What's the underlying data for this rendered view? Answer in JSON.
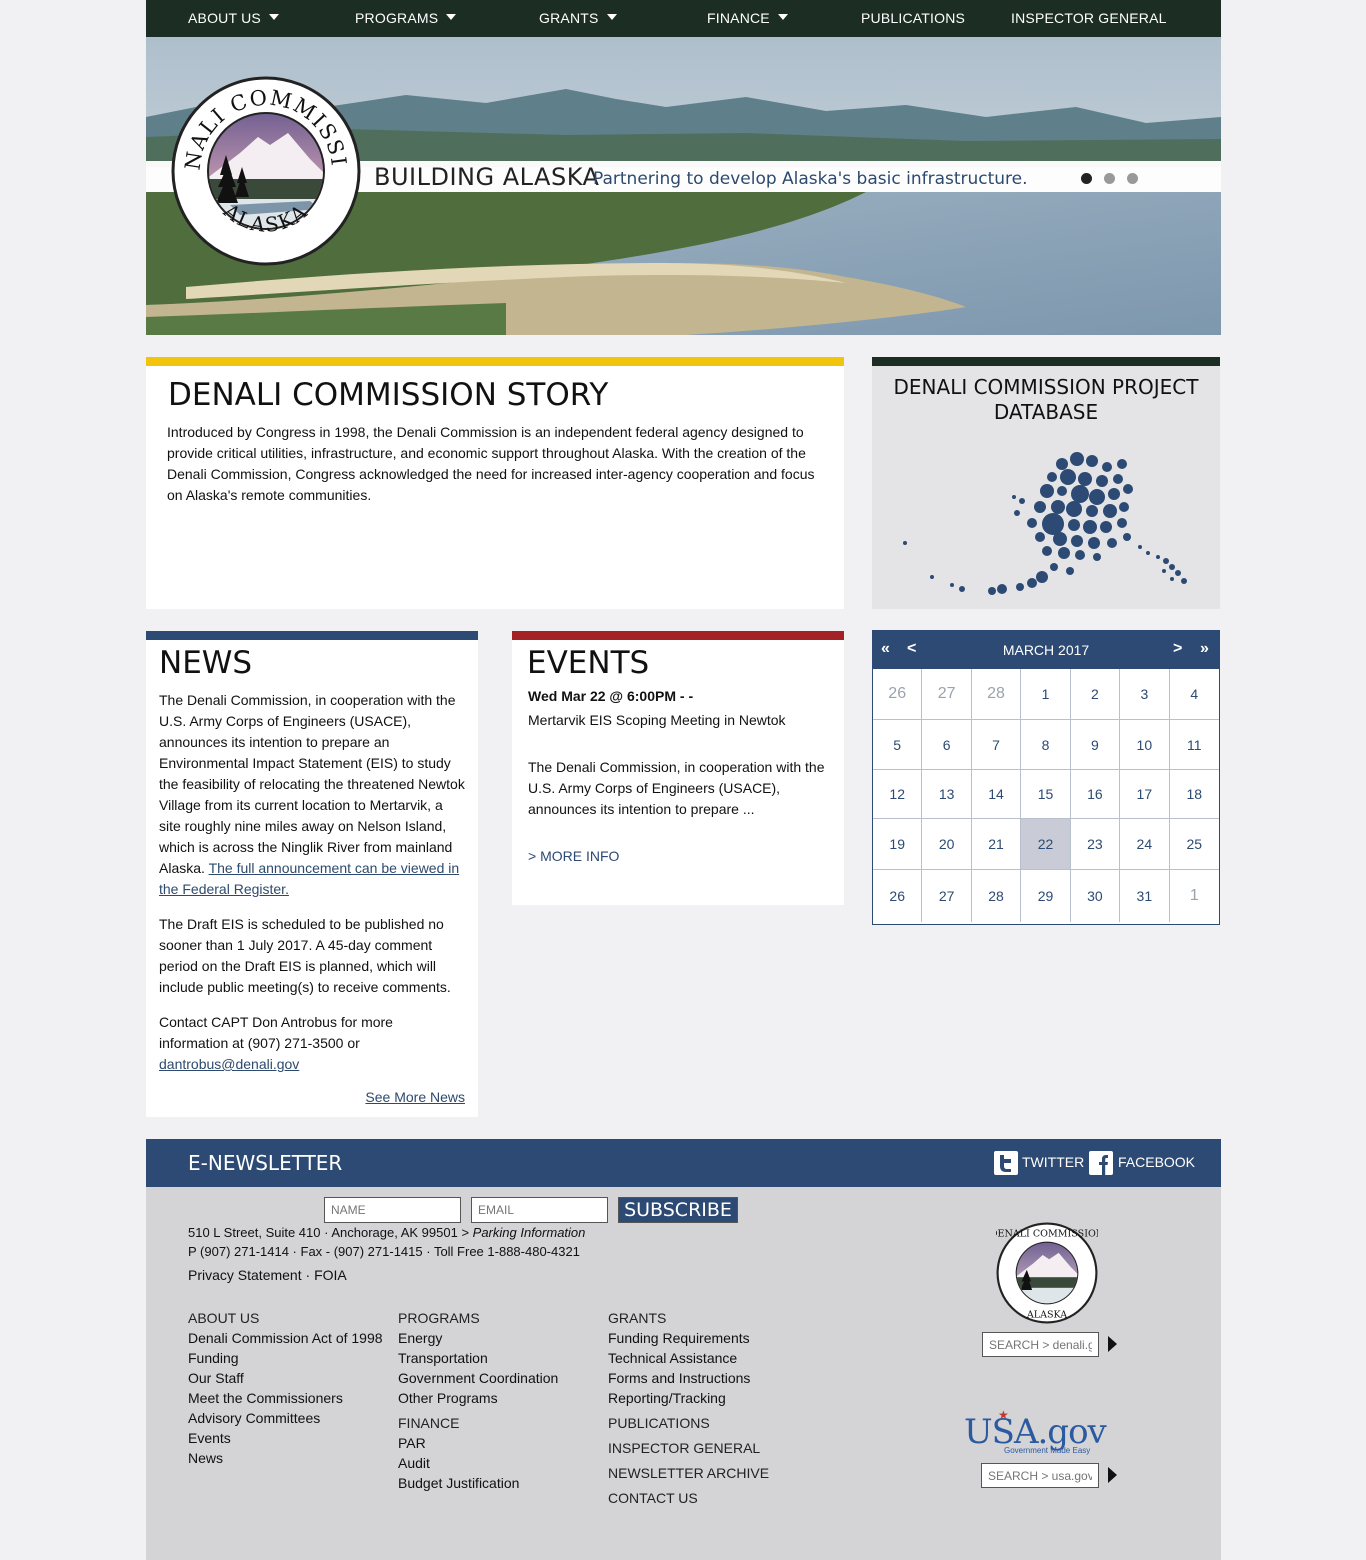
{
  "nav": {
    "items": [
      {
        "label": "ABOUT US",
        "dropdown": true
      },
      {
        "label": "PROGRAMS",
        "dropdown": true
      },
      {
        "label": "GRANTS",
        "dropdown": true
      },
      {
        "label": "FINANCE",
        "dropdown": true
      },
      {
        "label": "PUBLICATIONS",
        "dropdown": false
      },
      {
        "label": "INSPECTOR GENERAL",
        "dropdown": false
      }
    ]
  },
  "hero": {
    "title": "BUILDING ALASKA",
    "subtitle": "Partnering to develop Alaska's basic infrastructure.",
    "slide_count": 3,
    "active_slide": 1
  },
  "seal": {
    "top_text": "DENALI COMMISSION",
    "bottom_text": "ALASKA"
  },
  "story": {
    "title": "DENALI COMMISSION STORY",
    "body": "Introduced by Congress in 1998, the Denali Commission is an independent federal agency designed to provide critical utilities, infrastructure, and economic support throughout Alaska. With the creation of the Denali Commission, Congress acknowledged the need for increased inter-agency cooperation and focus on Alaska's remote communities."
  },
  "project_db": {
    "title": "DENALI COMMISSION PROJECT DATABASE"
  },
  "news": {
    "title": "NEWS",
    "para1": "The Denali Commission, in cooperation with the U.S. Army Corps of Engineers (USACE), announces its intention to prepare an Environmental Impact Statement (EIS) to study the feasibility of relocating the threatened Newtok Village from its current location to Mertarvik, a site roughly nine miles away on Nelson Island, which is across the Ninglik River from mainland Alaska.",
    "para1_link": "The full announcement can be viewed in the Federal Register.",
    "para2": "The Draft EIS is scheduled to be published no sooner than 1 July 2017. A 45-day comment period on the Draft EIS is planned, which will include public meeting(s) to receive comments.",
    "para3": "Contact CAPT Don Antrobus for more information at (907) 271-3500 or",
    "email": "dantrobus@denali.gov",
    "more": "See More News"
  },
  "events": {
    "title": "EVENTS",
    "date": "Wed Mar 22 @ 6:00PM - -",
    "name": "Mertarvik EIS Scoping Meeting in Newtok",
    "body": "The Denali Commission, in cooperation with the U.S. Army Corps of Engineers (USACE), announces its intention to prepare ...",
    "more": "> MORE INFO"
  },
  "calendar": {
    "month": "MARCH 2017",
    "first": "«",
    "prev": "<",
    "next": ">",
    "last": "»",
    "weeks": [
      [
        {
          "d": "26",
          "m": true
        },
        {
          "d": "27",
          "m": true
        },
        {
          "d": "28",
          "m": true
        },
        {
          "d": "1"
        },
        {
          "d": "2"
        },
        {
          "d": "3"
        },
        {
          "d": "4"
        }
      ],
      [
        {
          "d": "5"
        },
        {
          "d": "6"
        },
        {
          "d": "7"
        },
        {
          "d": "8"
        },
        {
          "d": "9"
        },
        {
          "d": "10"
        },
        {
          "d": "11"
        }
      ],
      [
        {
          "d": "12"
        },
        {
          "d": "13"
        },
        {
          "d": "14"
        },
        {
          "d": "15"
        },
        {
          "d": "16"
        },
        {
          "d": "17"
        },
        {
          "d": "18"
        }
      ],
      [
        {
          "d": "19"
        },
        {
          "d": "20"
        },
        {
          "d": "21"
        },
        {
          "d": "22",
          "t": true
        },
        {
          "d": "23"
        },
        {
          "d": "24"
        },
        {
          "d": "25"
        }
      ],
      [
        {
          "d": "26"
        },
        {
          "d": "27"
        },
        {
          "d": "28"
        },
        {
          "d": "29"
        },
        {
          "d": "30"
        },
        {
          "d": "31"
        },
        {
          "d": "1",
          "m": true
        }
      ]
    ]
  },
  "newsletter": {
    "title": "E-NEWSLETTER",
    "twitter": "TWITTER",
    "facebook": "FACEBOOK",
    "name_placeholder": "NAME",
    "email_placeholder": "EMAIL",
    "subscribe": "SUBSCRIBE"
  },
  "footer": {
    "address": "510 L Street, Suite 410 · Anchorage, AK 99501 >",
    "parking": "Parking Information",
    "phones": "P (907) 271-1414 · Fax - (907) 271-1415 · Toll Free 1-888-480-4321",
    "privacy": "Privacy Statement",
    "sep": "·",
    "foia": "FOIA",
    "col1": [
      "ABOUT US",
      "Denali Commission Act of 1998",
      "Funding",
      "Our Staff",
      "Meet the Commissioners",
      "Advisory Committees",
      "Events",
      "News"
    ],
    "col2a": [
      "PROGRAMS",
      "Energy",
      "Transportation",
      "Government Coordination",
      "Other Programs"
    ],
    "col2b": [
      "FINANCE",
      "PAR",
      "Audit",
      "Budget Justification"
    ],
    "col3a": [
      "GRANTS",
      "Funding Requirements",
      "Technical Assistance",
      "Forms and Instructions",
      "Reporting/Tracking"
    ],
    "col3b": [
      "PUBLICATIONS",
      "INSPECTOR GENERAL",
      "NEWSLETTER ARCHIVE",
      "CONTACT US"
    ],
    "search_denali": "SEARCH > denali.g",
    "search_usa": "SEARCH > usa.gov",
    "usa_logo": "USA.gov",
    "usa_tagline": "Government Made Easy"
  },
  "colors": {
    "nav": "#1c2e24",
    "navy": "#2c4a73",
    "story_bar": "#f2c40c",
    "events_bar": "#a42225",
    "db_bar": "#1c2e24"
  }
}
